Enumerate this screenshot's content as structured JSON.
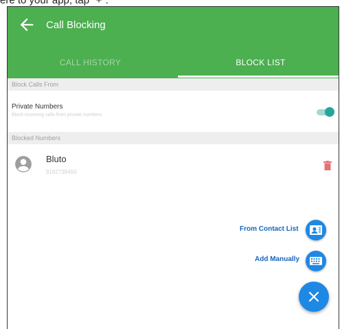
{
  "caption": "ere to your app, tap \"+\".",
  "app_bar": {
    "title": "Call Blocking"
  },
  "tabs": [
    {
      "label": "CALL HISTORY",
      "active": false
    },
    {
      "label": "BLOCK LIST",
      "active": true
    }
  ],
  "sections": {
    "block_calls_from": "Block Calls From",
    "blocked_numbers": "Blocked Numbers"
  },
  "private_numbers": {
    "title": "Private Numbers",
    "subtitle": "Block incoming calls from private numbers",
    "enabled": true
  },
  "blocked": [
    {
      "name": "Bluto",
      "number": "9182738450"
    }
  ],
  "fab_menu": {
    "from_contact_list": "From Contact List",
    "add_manually": "Add Manually"
  },
  "colors": {
    "app_bar": "#4caf50",
    "toggle": "#26a69a",
    "fab": "#1e88e5",
    "delete": "#e57373"
  },
  "icons": {
    "back": "arrow-left-icon",
    "avatar": "account-circle-icon",
    "delete": "trash-icon",
    "contacts": "contact-list-icon",
    "keyboard": "keyboard-icon",
    "close": "close-icon"
  }
}
